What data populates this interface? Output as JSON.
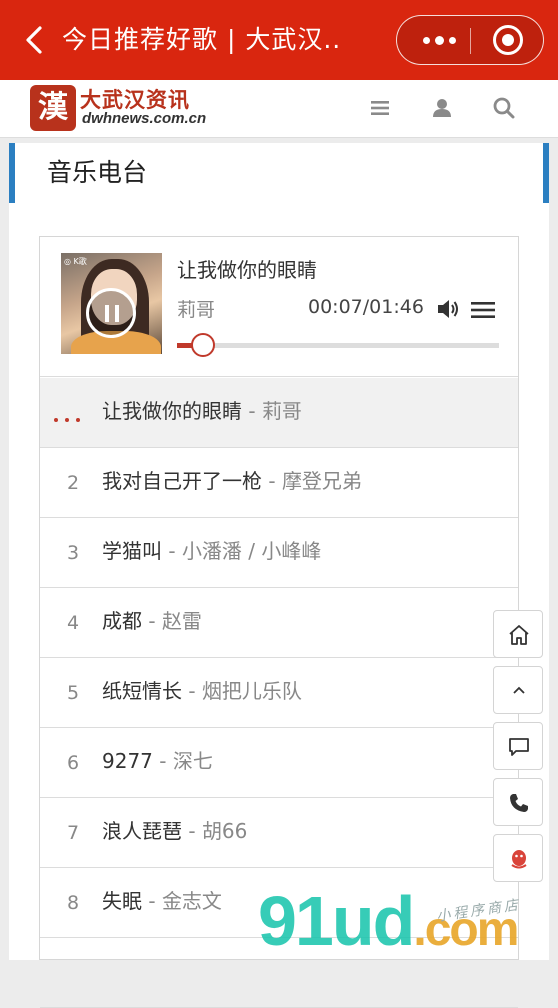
{
  "window": {
    "title": "今日推荐好歌 | 大武汉.."
  },
  "site": {
    "logo_cn": "大武汉资讯",
    "logo_en": "dwhnews.com.cn",
    "logo_mark": "漢"
  },
  "panel": {
    "title": "音乐电台"
  },
  "player": {
    "cover_tag": "◎ K歌",
    "song": "让我做你的眼睛",
    "artist": "莉哥",
    "time": "00:07/01:46",
    "progress_fraction": 0.08
  },
  "playlist": [
    {
      "num": "",
      "title": "让我做你的眼睛",
      "sep": " - ",
      "artist": "莉哥",
      "active": true
    },
    {
      "num": "2",
      "title": "我对自己开了一枪",
      "sep": " - ",
      "artist": "摩登兄弟",
      "active": false
    },
    {
      "num": "3",
      "title": "学猫叫",
      "sep": " - ",
      "artist": "小潘潘 / 小峰峰",
      "active": false
    },
    {
      "num": "4",
      "title": "成都",
      "sep": " - ",
      "artist": "赵雷",
      "active": false
    },
    {
      "num": "5",
      "title": "纸短情长",
      "sep": " - ",
      "artist": "烟把儿乐队",
      "active": false
    },
    {
      "num": "6",
      "title": "9277",
      "sep": " - ",
      "artist": "深七",
      "active": false
    },
    {
      "num": "7",
      "title": "浪人琵琶",
      "sep": " - ",
      "artist": "胡66",
      "active": false
    },
    {
      "num": "8",
      "title": "失眠",
      "sep": " - ",
      "artist": "金志文",
      "active": false
    },
    {
      "num": "",
      "title": "",
      "sep": "",
      "artist": "",
      "active": false
    }
  ],
  "floating_icons": [
    "home-icon",
    "chevron-up-icon",
    "comment-icon",
    "phone-icon",
    "qq-icon"
  ],
  "watermark": {
    "main": "91ud",
    "suffix": ".com",
    "small": "小程序商店"
  },
  "colors": {
    "topbar": "#d9260f",
    "accent_blue": "#2b7fc1",
    "progress": "#c0392b"
  }
}
